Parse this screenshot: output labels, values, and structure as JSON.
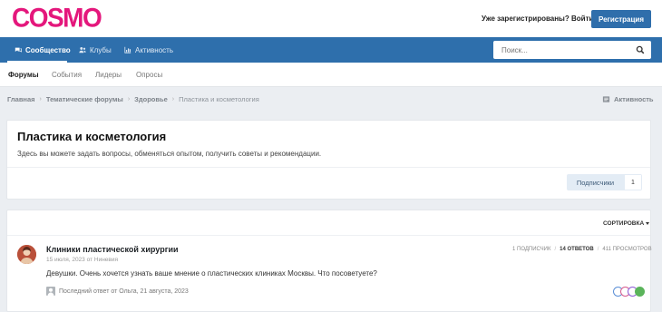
{
  "header": {
    "logo": "COSMO",
    "signin_label": "Уже зарегистрированы? Войти",
    "register_label": "Регистрация"
  },
  "nav": {
    "items": [
      {
        "label": "Сообщество",
        "icon": "comments-icon",
        "active": true
      },
      {
        "label": "Клубы",
        "icon": "users-icon",
        "active": false
      },
      {
        "label": "Активность",
        "icon": "bar-chart-icon",
        "active": false
      }
    ],
    "search_placeholder": "Поиск..."
  },
  "subnav": {
    "items": [
      "Форумы",
      "События",
      "Лидеры",
      "Опросы"
    ]
  },
  "breadcrumb": {
    "items": [
      "Главная",
      "Тематические форумы",
      "Здоровье",
      "Пластика и косметология"
    ],
    "activity_label": "Активность"
  },
  "forum": {
    "title": "Пластика и косметология",
    "description": "Здесь вы можете задать вопросы, обменяться опытом, получить советы и рекомендации.",
    "follow_label": "Подписчики",
    "follow_count": "1"
  },
  "topics": {
    "sort_label": "СОРТИРОВКА",
    "list": [
      {
        "title": "Клиники пластической хирургии",
        "date": "15 июля, 2023",
        "author_prefix": "от",
        "author": "Ниневия",
        "stats": {
          "followers": "1 ПОДПИСЧИК",
          "replies": "14 ОТВЕТОВ",
          "views": "411 ПРОСМОТРОВ"
        },
        "snippet": "Девушки. Очень хочется узнать ваше мнение о пластических клиниках Москвы. Что посоветуете?",
        "last_reply": "Последний ответ от Ольга, 21 августа, 2023"
      }
    ]
  },
  "colors": {
    "brand_pink": "#e4177c",
    "nav_blue": "#2e6fac",
    "button_blue": "#2f6eab"
  }
}
